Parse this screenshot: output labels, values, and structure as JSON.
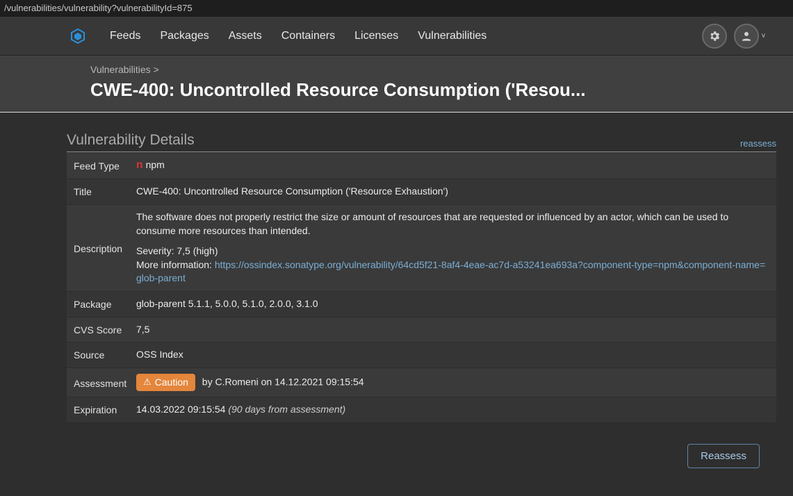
{
  "addressBar": "/vulnerabilities/vulnerability?vulnerabilityId=875",
  "nav": {
    "items": [
      "Feeds",
      "Packages",
      "Assets",
      "Containers",
      "Licenses",
      "Vulnerabilities"
    ],
    "userChevron": "v"
  },
  "breadcrumb": {
    "parent": "Vulnerabilities",
    "sep": " >"
  },
  "pageTitle": "CWE-400: Uncontrolled Resource Consumption ('Resou...",
  "section": {
    "title": "Vulnerability Details",
    "reassessLink": "reassess"
  },
  "details": {
    "feedType": {
      "label": "Feed Type",
      "icon": "n",
      "value": "npm"
    },
    "title": {
      "label": "Title",
      "value": "CWE-400: Uncontrolled Resource Consumption ('Resource Exhaustion')"
    },
    "description": {
      "label": "Description",
      "para": "The software does not properly restrict the size or amount of resources that are requested or influenced by an actor, which can be used to consume more resources than intended.",
      "severityLine": "Severity: 7,5 (high)",
      "moreInfoPrefix": "More information: ",
      "moreInfoUrl": "https://ossindex.sonatype.org/vulnerability/64cd5f21-8af4-4eae-ac7d-a53241ea693a?component-type=npm&component-name=glob-parent"
    },
    "package": {
      "label": "Package",
      "value": "glob-parent 5.1.1, 5.0.0, 5.1.0, 2.0.0, 3.1.0"
    },
    "cvsScore": {
      "label": "CVS Score",
      "value": "7,5"
    },
    "source": {
      "label": "Source",
      "value": "OSS Index"
    },
    "assessment": {
      "label": "Assessment",
      "badge": "Caution",
      "by": " by C.Romeni on 14.12.2021 09:15:54"
    },
    "expiration": {
      "label": "Expiration",
      "value": "14.03.2022 09:15:54 ",
      "italic": "(90 days from assessment)"
    }
  },
  "footer": {
    "reassessButton": "Reassess"
  }
}
